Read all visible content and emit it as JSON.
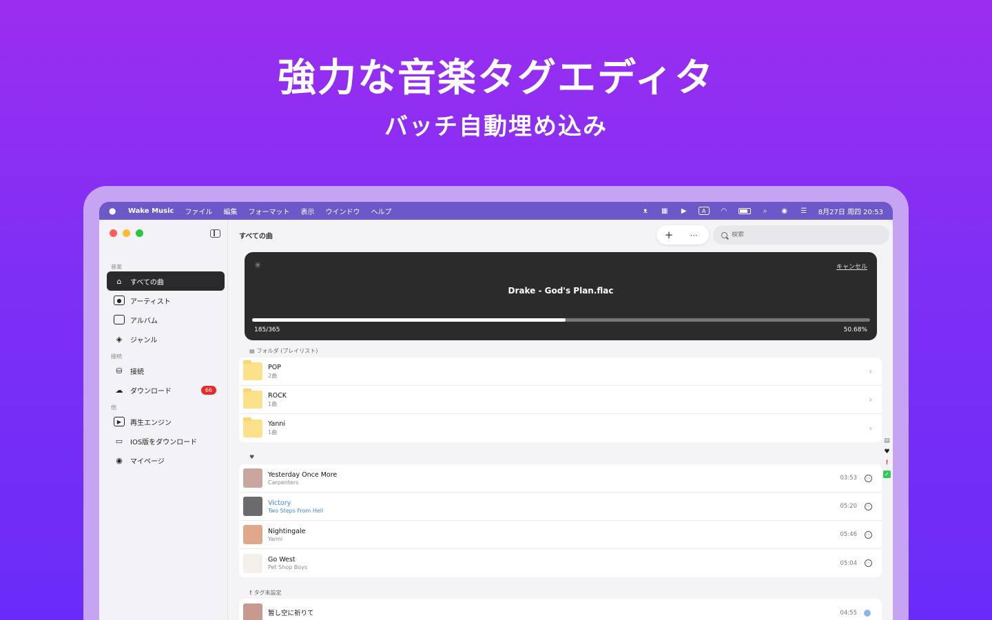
{
  "promo": {
    "headline": "強力な音楽タグエディタ",
    "subline": "バッチ自動埋め込み"
  },
  "menubar": {
    "items": [
      "Wake Music",
      "ファイル",
      "編集",
      "フォーマット",
      "表示",
      "ウインドウ",
      "ヘルプ"
    ],
    "status_icons": [
      "cat-icon",
      "grid-icon",
      "play-circle-icon",
      "input-a-icon",
      "wifi-icon",
      "battery-icon",
      "spotlight-icon",
      "siri-icon",
      "control-center-icon"
    ],
    "input_label": "A",
    "clock": "8月27日 周四 20:53"
  },
  "sidebar": {
    "section_music": "音楽",
    "section_connect": "接続",
    "section_other": "他",
    "items": [
      {
        "label": "すべての曲",
        "icon": "home-icon"
      },
      {
        "label": "アーティスト",
        "icon": "person-icon"
      },
      {
        "label": "アルバム",
        "icon": "album-icon"
      },
      {
        "label": "ジャンル",
        "icon": "layers-icon"
      },
      {
        "label": "接続",
        "icon": "drive-icon"
      },
      {
        "label": "ダウンロード",
        "icon": "cloud-download-icon",
        "badge": "66"
      },
      {
        "label": "再生エンジン",
        "icon": "play-square-icon"
      },
      {
        "label": "IOS版をダウンロード",
        "icon": "devices-icon"
      },
      {
        "label": "マイページ",
        "icon": "user-circle-icon"
      }
    ]
  },
  "main": {
    "title": "すべての曲",
    "add_label": "+",
    "more_label": "⋯",
    "search_placeholder": "検索"
  },
  "progress": {
    "cancel": "キャンセル",
    "file": "Drake  - God's Plan.flac",
    "count": "185/365",
    "percent": "50.68%",
    "fraction": 0.5068
  },
  "folders": {
    "label": "フォルダ (プレイリスト)",
    "items": [
      {
        "name": "POP",
        "count": "2曲"
      },
      {
        "name": "ROCK",
        "count": "1曲"
      },
      {
        "name": "Yanni",
        "count": "1曲"
      }
    ]
  },
  "favorites": {
    "songs": [
      {
        "title": "Yesterday Once More",
        "artist": "Carpenters",
        "duration": "03:53",
        "art": "#c9a6a0"
      },
      {
        "title": "Victory",
        "artist": "Two Steps From Hell",
        "duration": "05:20",
        "art": "#6b6b6f"
      },
      {
        "title": "Nightingale",
        "artist": "Yanni",
        "duration": "05:46",
        "art": "#e0a88a"
      },
      {
        "title": "Go West",
        "artist": "Pet Shop Boys",
        "duration": "05:04",
        "art": "#f4efe8"
      }
    ]
  },
  "untagged": {
    "label": "タグ未設定",
    "songs": [
      {
        "title": "暂し空に祈りて",
        "duration": "04:55",
        "art": "#c8998f"
      }
    ]
  },
  "colors": {
    "accent": "#3b86d8",
    "badge": "#e8282b",
    "menubar": "#6d58c9"
  }
}
